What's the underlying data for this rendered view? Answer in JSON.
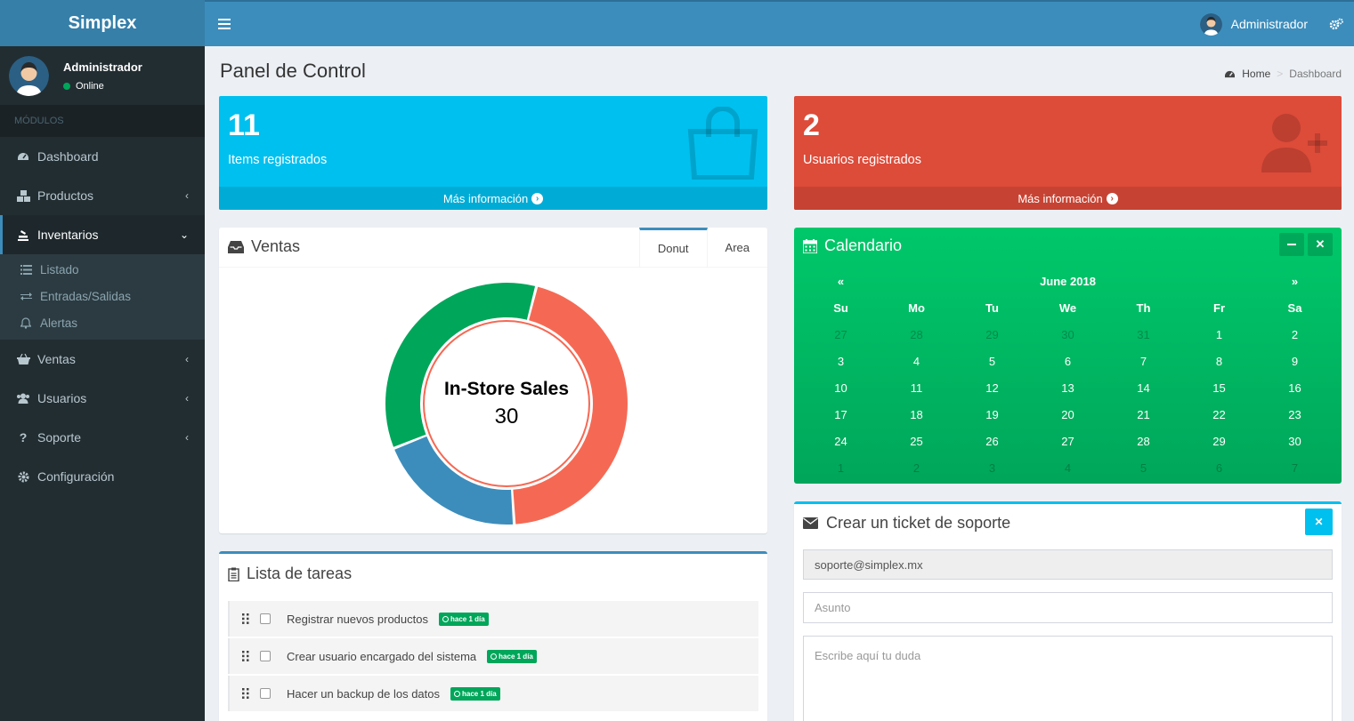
{
  "app": {
    "logo": "Simplex"
  },
  "navbar": {
    "user_name": "Administrador"
  },
  "sidebar": {
    "user": {
      "name": "Administrador",
      "status": "Online"
    },
    "section_header": "MÓDULOS",
    "items": [
      {
        "label": "Dashboard"
      },
      {
        "label": "Productos"
      },
      {
        "label": "Inventarios"
      },
      {
        "label": "Ventas"
      },
      {
        "label": "Usuarios"
      },
      {
        "label": "Soporte"
      },
      {
        "label": "Configuración"
      }
    ],
    "inventarios_sub": [
      {
        "label": "Listado"
      },
      {
        "label": "Entradas/Salidas"
      },
      {
        "label": "Alertas"
      }
    ]
  },
  "page": {
    "title": "Panel de Control",
    "breadcrumb": {
      "home": "Home",
      "current": "Dashboard"
    }
  },
  "stats": [
    {
      "value": "11",
      "label": "Items registrados",
      "link": "Más información",
      "color": "#00c0ef"
    },
    {
      "value": "2",
      "label": "Usuarios registrados",
      "link": "Más información",
      "color": "#dd4b39"
    }
  ],
  "ventas": {
    "title": "Ventas",
    "tabs": [
      "Donut",
      "Area"
    ],
    "center_label": "In-Store Sales",
    "center_value": "30"
  },
  "chart_data": {
    "type": "pie",
    "segments": [
      {
        "value": 45,
        "color": "#f56954"
      },
      {
        "value": 20,
        "color": "#3c8dbc"
      },
      {
        "value": 35,
        "color": "#00a65a"
      }
    ]
  },
  "calendar": {
    "title": "Calendario",
    "prev": "«",
    "next": "»",
    "month": "June 2018",
    "weekdays": [
      "Su",
      "Mo",
      "Tu",
      "We",
      "Th",
      "Fr",
      "Sa"
    ],
    "weeks": [
      [
        "27",
        "28",
        "29",
        "30",
        "31",
        "1",
        "2"
      ],
      [
        "3",
        "4",
        "5",
        "6",
        "7",
        "8",
        "9"
      ],
      [
        "10",
        "11",
        "12",
        "13",
        "14",
        "15",
        "16"
      ],
      [
        "17",
        "18",
        "19",
        "20",
        "21",
        "22",
        "23"
      ],
      [
        "24",
        "25",
        "26",
        "27",
        "28",
        "29",
        "30"
      ],
      [
        "1",
        "2",
        "3",
        "4",
        "5",
        "6",
        "7"
      ]
    ],
    "color": "#00a65a"
  },
  "tasks": {
    "title": "Lista de tareas",
    "items": [
      {
        "text": "Registrar nuevos productos",
        "badge": "hace 1 día"
      },
      {
        "text": "Crear usuario encargado del sistema",
        "badge": "hace 1 día"
      },
      {
        "text": "Hacer un backup de los datos",
        "badge": "hace 1 día"
      }
    ]
  },
  "support": {
    "title": "Crear un ticket de soporte",
    "email": "soporte@simplex.mx",
    "subject_placeholder": "Asunto",
    "message_placeholder": "Escribe aquí tu duda"
  }
}
